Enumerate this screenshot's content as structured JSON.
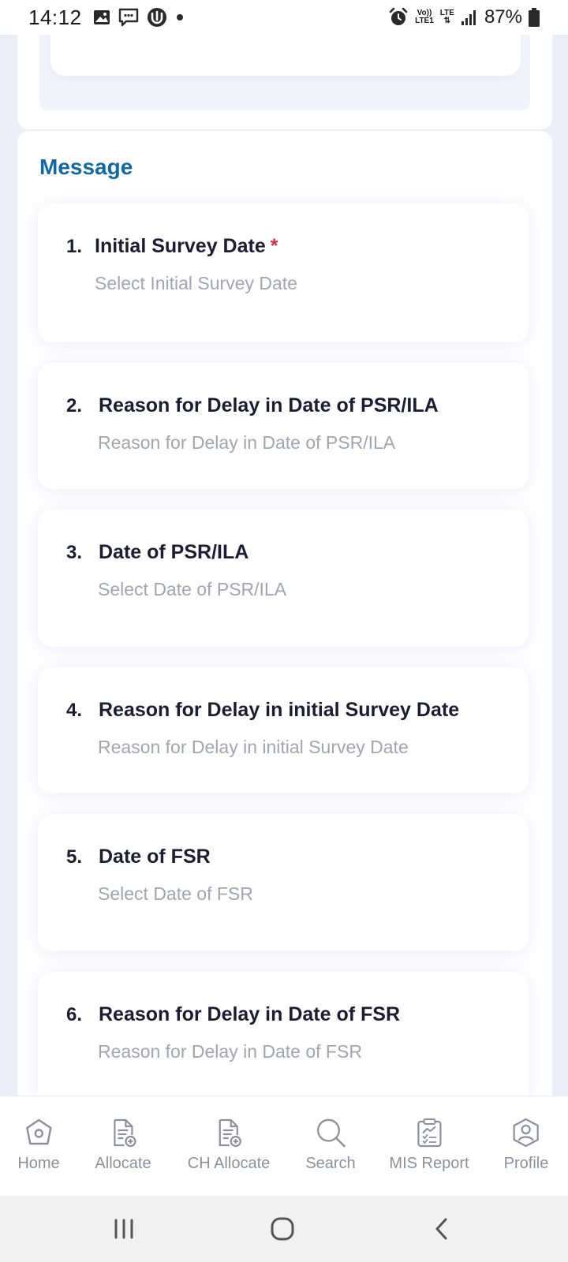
{
  "status_bar": {
    "time": "14:12",
    "battery_percent": "87%",
    "network_volte": "Vo))",
    "network_lte1": "LTE1",
    "network_lte": "LTE"
  },
  "message_section": {
    "title": "Message"
  },
  "fields": [
    {
      "number": "1.",
      "label": "Initial Survey Date",
      "required": true,
      "placeholder": "Select Initial Survey Date"
    },
    {
      "number": "2.",
      "label": "Reason for Delay in Date of PSR/ILA",
      "required": false,
      "placeholder": "Reason for Delay in Date of PSR/ILA"
    },
    {
      "number": "3.",
      "label": "Date of PSR/ILA",
      "required": false,
      "placeholder": "Select Date of PSR/ILA"
    },
    {
      "number": "4.",
      "label": "Reason for Delay in initial Survey Date",
      "required": false,
      "placeholder": "Reason for Delay in initial Survey Date"
    },
    {
      "number": "5.",
      "label": "Date of FSR",
      "required": false,
      "placeholder": "Select Date of FSR"
    },
    {
      "number": "6.",
      "label": "Reason for Delay in Date of FSR",
      "required": false,
      "placeholder": "Reason for Delay in Date of FSR"
    }
  ],
  "required_marker": "*",
  "bottom_nav": [
    {
      "label": "Home",
      "icon": "home-icon"
    },
    {
      "label": "Allocate",
      "icon": "allocate-icon"
    },
    {
      "label": "CH Allocate",
      "icon": "ch-allocate-icon"
    },
    {
      "label": "Search",
      "icon": "search-icon"
    },
    {
      "label": "MIS Report",
      "icon": "report-icon"
    },
    {
      "label": "Profile",
      "icon": "profile-icon"
    }
  ],
  "colors": {
    "accent": "#0f6aa3",
    "required": "#d32f3c",
    "placeholder": "#a2a4b4",
    "nav_icon": "#8d8fa0"
  }
}
